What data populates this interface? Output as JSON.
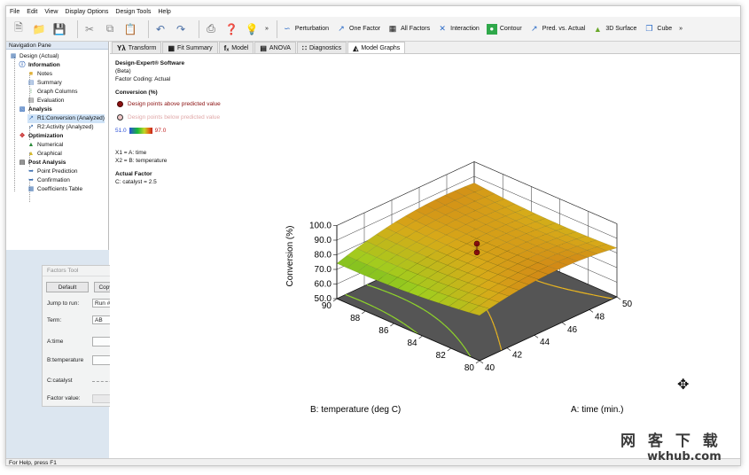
{
  "menu": [
    "File",
    "Edit",
    "View",
    "Display Options",
    "Design Tools",
    "Help"
  ],
  "toolbar": {
    "icons": [
      "new-file-icon",
      "open-folder-icon",
      "save-icon",
      "cut-icon",
      "copy-icon",
      "paste-icon",
      "undo-icon",
      "redo-icon",
      "print-icon",
      "help-icon",
      "tip-icon"
    ],
    "overflow": "»",
    "graph_buttons": [
      "Perturbation",
      "One Factor",
      "All Factors",
      "Interaction",
      "Contour",
      "Pred. vs. Actual",
      "3D Surface",
      "Cube"
    ]
  },
  "nav": {
    "title": "Navigation Pane",
    "root": "Design (Actual)",
    "information": "Information",
    "notes": "Notes",
    "summary": "Summary",
    "graph_columns": "Graph Columns",
    "evaluation": "Evaluation",
    "analysis": "Analysis",
    "r1": "R1:Conversion (Analyzed)",
    "r2": "R2:Activity (Analyzed)",
    "optimization": "Optimization",
    "numerical": "Numerical",
    "graphical": "Graphical",
    "post_analysis": "Post Analysis",
    "point_prediction": "Point Prediction",
    "confirmation": "Confirmation",
    "coefficients_table": "Coefficients Table"
  },
  "factors_tool": {
    "title": "Factors Tool",
    "default_btn": "Default",
    "copy_paste_btn": "Copy/Paste...",
    "jump_to_run_label": "Jump to run:",
    "jump_to_run_value": "Run #",
    "term_label": "Term:",
    "term_value": "AB",
    "a_label": "A:time",
    "a_value": "X1",
    "b_label": "B:temperature",
    "b_value": "X2",
    "c_label": "C:catalyst",
    "c_level": 0.5,
    "factor_value_label": "Factor value:"
  },
  "tabs": [
    "Transform",
    "Fit Summary",
    "Model",
    "ANOVA",
    "Diagnostics",
    "Model Graphs"
  ],
  "tab_icons": [
    "Yλ",
    "▦",
    "fₓ",
    "▤",
    "∷",
    "◭"
  ],
  "info": {
    "software": "Design-Expert® Software",
    "beta": "(Beta)",
    "factor_coding": "Factor Coding: Actual",
    "response": "Conversion (%)",
    "above": "Design points above predicted value",
    "below": "Design points below predicted value",
    "cb_min": "51.0",
    "cb_max": "97.0",
    "x1": "X1 = A: time",
    "x2": "X2 = B: temperature",
    "actual_factor": "Actual Factor",
    "catalyst": "C: catalyst = 2.5"
  },
  "colors": {
    "above": "#8b0f0f",
    "below": "#f0c8c8",
    "cb_min": "#2b4fd8",
    "cb_max": "#c11e1e"
  },
  "status": "For Help, press F1",
  "watermark": {
    "cn": "网 客 下 载",
    "en": "wkhub.com"
  },
  "chart_data": {
    "type": "surface",
    "zlabel": "Conversion (%)",
    "xlabel": "A: time (min.)",
    "ylabel": "B: temperature (deg C)",
    "z_ticks": [
      "50.0",
      "60.0",
      "70.0",
      "80.0",
      "90.0",
      "100.0"
    ],
    "x_ticks": [
      "40",
      "42",
      "44",
      "46",
      "48",
      "50"
    ],
    "y_ticks": [
      "80",
      "82",
      "84",
      "86",
      "88",
      "90"
    ],
    "zlim": [
      50,
      100
    ],
    "xlim": [
      40,
      50
    ],
    "ylim": [
      80,
      90
    ],
    "design_points": [
      {
        "time": 45,
        "temperature": 85,
        "conversion": 87
      },
      {
        "time": 45,
        "temperature": 85,
        "conversion": 81
      }
    ]
  }
}
